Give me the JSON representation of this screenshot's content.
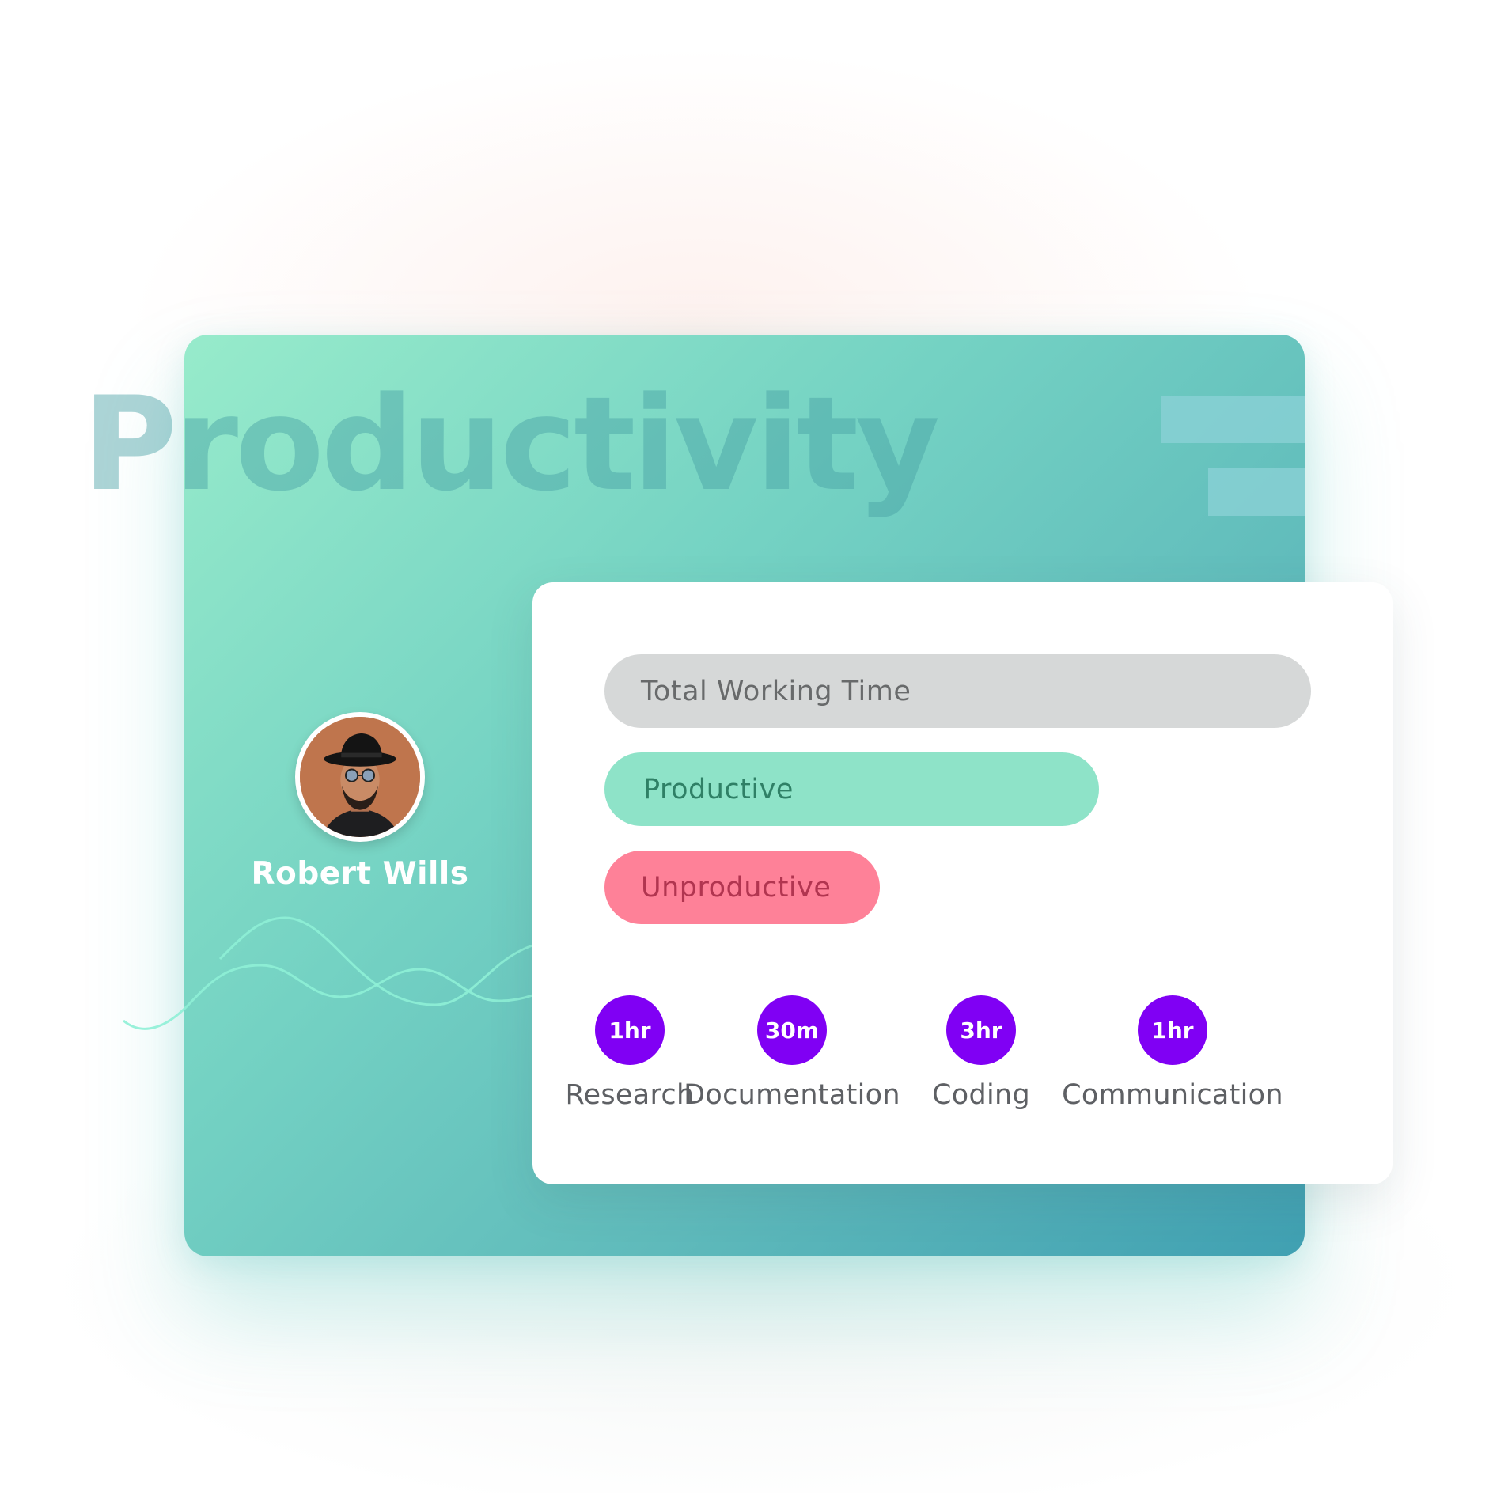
{
  "page": {
    "background_title": "Productivity"
  },
  "profile": {
    "name": "Robert Wills",
    "avatar_icon": "user-avatar-photo"
  },
  "summary": {
    "total_label": "Total Working Time",
    "productive_label": "Productive",
    "unproductive_label": "Unproductive",
    "productive_fraction": 0.7,
    "unproductive_fraction": 0.39
  },
  "activities": [
    {
      "duration": "1hr",
      "label": "Research"
    },
    {
      "duration": "30m",
      "label": "Documentation"
    },
    {
      "duration": "3hr",
      "label": "Coding"
    },
    {
      "duration": "1hr",
      "label": "Communication"
    }
  ],
  "colors": {
    "card_gradient_start": "#97ebcb",
    "card_gradient_end": "#40a0b2",
    "total_pill": "#d6d8d8",
    "productive_pill": "#8ee3c8",
    "unproductive_pill": "#fe8198",
    "activity_badge": "#8000f4"
  }
}
